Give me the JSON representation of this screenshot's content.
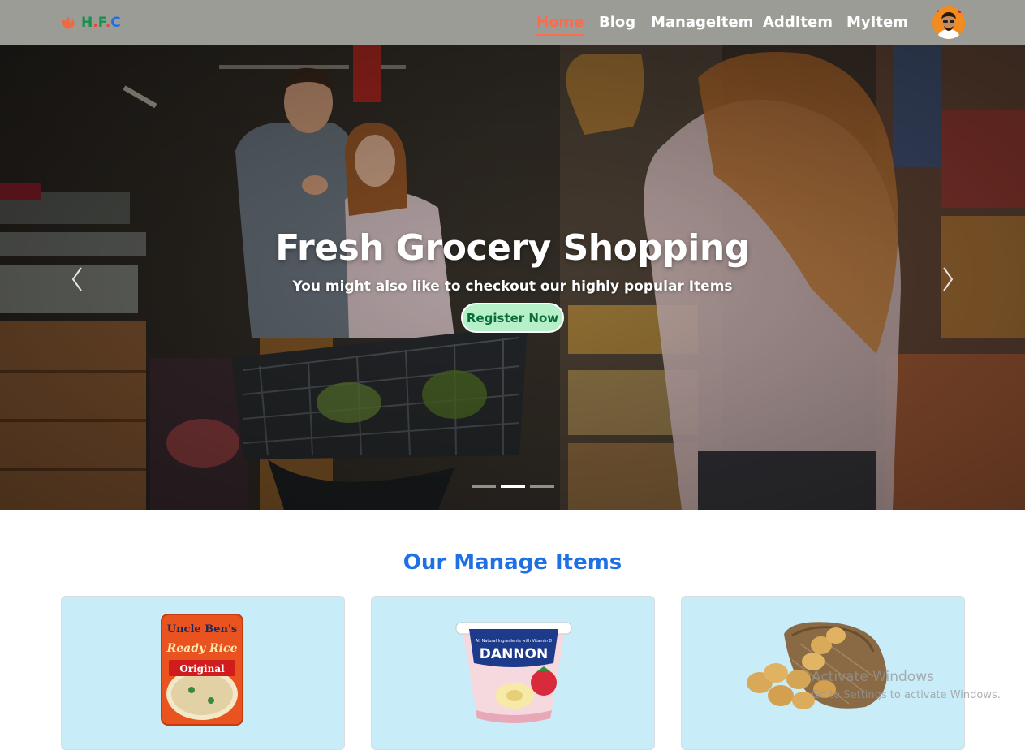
{
  "brand": {
    "text_h": "H",
    "dot1": ".",
    "text_f": "F",
    "dot2": ".",
    "text_c": "C",
    "logo_icon": "fire-icon"
  },
  "nav": {
    "items": [
      {
        "label": "Home",
        "active": true
      },
      {
        "label": "Blog",
        "active": false
      },
      {
        "label": "ManageItem",
        "active": false
      },
      {
        "label": "AddItem",
        "active": false
      },
      {
        "label": "MyItem",
        "active": false
      }
    ],
    "avatar_icon": "user-avatar-icon"
  },
  "hero": {
    "title": "Fresh Grocery Shopping",
    "subtitle": "You might also like to checkout our highly popular Items",
    "button_label": "Register Now",
    "prev_icon": "chevron-left-icon",
    "next_icon": "chevron-right-icon",
    "slide_count": 3,
    "active_slide": 2
  },
  "section": {
    "title": "Our Manage Items",
    "items": [
      {
        "image_icon": "rice-pack-icon",
        "brand_text": "Uncle Ben's",
        "product_text": "Ready Rice",
        "variant_text": "Original"
      },
      {
        "image_icon": "yogurt-cup-icon",
        "brand_text": "DANNON",
        "product_text": "All Natural Ingredients with Vitamin D"
      },
      {
        "image_icon": "potato-sack-icon"
      }
    ]
  },
  "watermark": {
    "line1": "Activate Windows",
    "line2": "Go to Settings to activate Windows."
  },
  "colors": {
    "navbar": "#9c9c97",
    "active_link": "#ff6a4a",
    "section_title": "#1f6fe5",
    "card_bg": "#c9ecf9",
    "button_bg": "#b6f0c8"
  }
}
